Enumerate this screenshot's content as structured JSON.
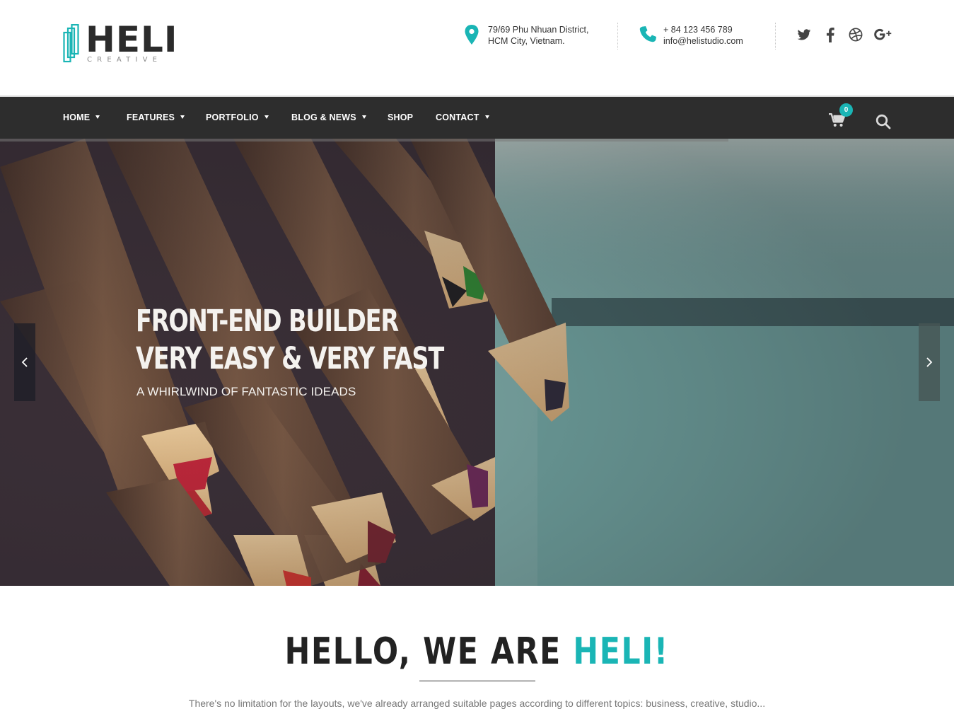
{
  "brand": {
    "name": "HELI",
    "tagline": "CREATIVE",
    "accent_color": "#1ab5b5",
    "dark_color": "#2d2d2d"
  },
  "header": {
    "address": {
      "icon": "map-pin-icon",
      "line1": "79/69 Phu Nhuan District,",
      "line2": "HCM City, Vietnam."
    },
    "phone": {
      "icon": "phone-icon",
      "line1": "+ 84 123 456 789",
      "line2": "info@helistudio.com"
    },
    "social": [
      {
        "name": "twitter-icon"
      },
      {
        "name": "facebook-icon"
      },
      {
        "name": "dribbble-icon"
      },
      {
        "name": "google-plus-icon"
      }
    ]
  },
  "nav": {
    "items": [
      {
        "label": "HOME",
        "dropdown": true
      },
      {
        "label": "FEATURES",
        "dropdown": true
      },
      {
        "label": "PORTFOLIO",
        "dropdown": true
      },
      {
        "label": "BLOG & NEWS",
        "dropdown": true
      },
      {
        "label": "SHOP",
        "dropdown": false
      },
      {
        "label": "CONTACT",
        "dropdown": true
      }
    ],
    "cart_count": "0",
    "cart_icon": "cart-icon",
    "search_icon": "search-icon"
  },
  "hero": {
    "line1": "FRONT-END BUILDER",
    "line2": "VERY EASY & VERY FAST",
    "subtitle": "A WHIRLWIND OF FANTASTIC IDEADS",
    "prev_icon": "chevron-left-icon",
    "next_icon": "chevron-right-icon"
  },
  "intro": {
    "title_main": "HELLO, WE ARE ",
    "title_accent": "HELI!",
    "text": "There's no limitation for the layouts, we've already arranged suitable pages according to different topics: business, creative, studio..."
  }
}
